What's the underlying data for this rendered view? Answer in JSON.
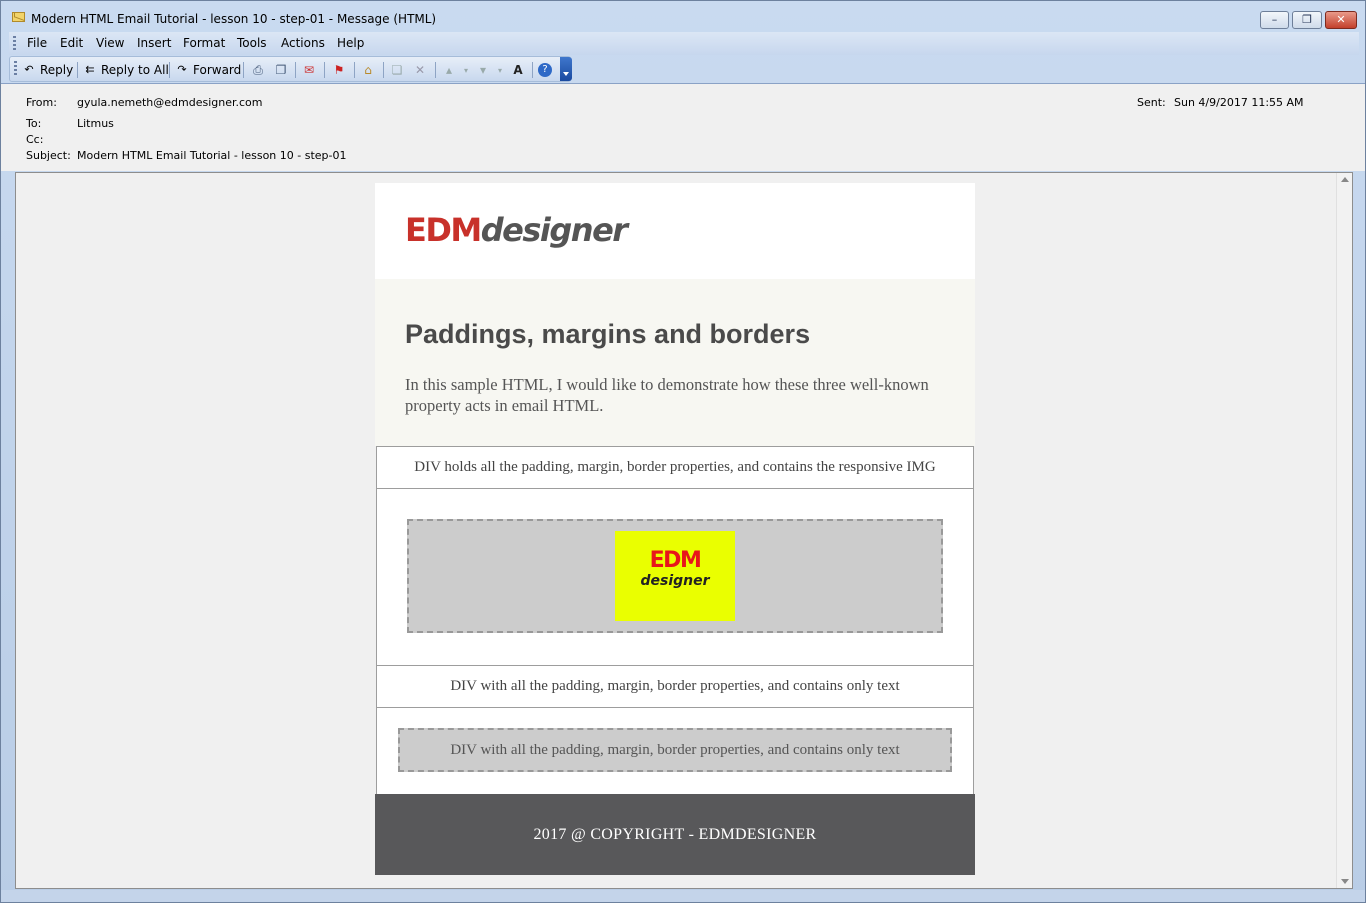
{
  "window": {
    "title": "Modern HTML Email Tutorial - lesson 10 - step-01 - Message (HTML)",
    "minimize": "–",
    "maximize": "❐",
    "close": "✕"
  },
  "menu": {
    "items": [
      "File",
      "Edit",
      "View",
      "Insert",
      "Format",
      "Tools",
      "Actions",
      "Help"
    ]
  },
  "toolbar": {
    "reply": "Reply",
    "reply_all": "Reply to All",
    "forward": "Forward",
    "font_size_glyph": "A",
    "help_glyph": "?"
  },
  "header": {
    "from_label": "From:",
    "from_value": "gyula.nemeth@edmdesigner.com",
    "to_label": "To:",
    "to_value": "Litmus",
    "cc_label": "Cc:",
    "cc_value": "",
    "subject_label": "Subject:",
    "subject_value": "Modern HTML Email Tutorial - lesson 10 - step-01",
    "sent_label": "Sent:",
    "sent_value": "Sun 4/9/2017 11:55 AM"
  },
  "email": {
    "logo_edm": "EDM",
    "logo_designer": "designer",
    "title": "Paddings, margins and borders",
    "intro": "In this sample HTML, I would like to demonstrate how these three well-known property acts in email HTML.",
    "img_label": "DIV holds all the padding, margin, border properties, and contains the responsive IMG",
    "img_logo_edm": "EDM",
    "img_logo_designer": "designer",
    "text_label": "DIV with all the padding, margin, border properties, and contains only text",
    "text_box": "DIV with all the padding, margin, border properties, and contains only text",
    "footer": "2017 @ COPYRIGHT - EDMDESIGNER"
  },
  "colors": {
    "brand_red": "#c8312a",
    "logo_gray": "#555555",
    "hero_bg": "#f7f7f2",
    "box_gray": "#cccccc",
    "image_yellow": "#eaff00",
    "footer_bg": "#58585a"
  },
  "icons": [
    "envelope-icon",
    "reply-icon",
    "reply-all-icon",
    "forward-icon",
    "print-icon",
    "copy-icon",
    "delete-junk-icon",
    "flag-icon",
    "address-book-icon",
    "move-icon",
    "delete-icon",
    "previous-icon",
    "next-icon",
    "font-size-icon",
    "help-icon"
  ]
}
